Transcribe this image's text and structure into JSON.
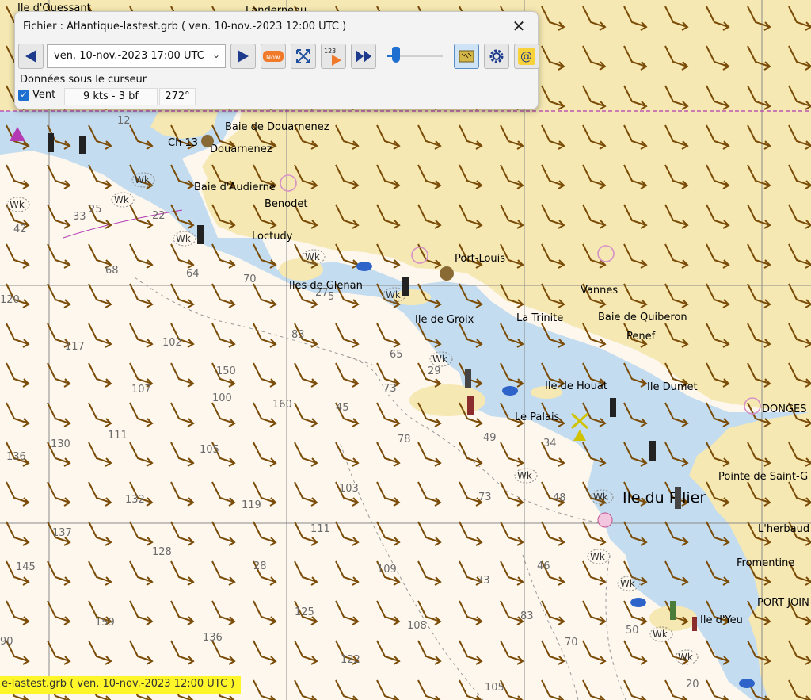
{
  "panel": {
    "title": "Fichier : Atlantique-lastest.grb ( ven. 10-nov.-2023 12:00  UTC )",
    "date_select": "ven. 10-nov.-2023 17:00  UTC",
    "now_label": "Now",
    "step_label": "123",
    "slider_fraction": 0.18,
    "cursor_header": "Données sous le curseur",
    "vent_label": "Vent",
    "vent_checked": true,
    "wind_speed": "9 kts -  3 bf",
    "wind_dir": "272°"
  },
  "status": {
    "text": "e-lastest.grb ( ven. 10-nov.-2023 12:00  UTC )"
  },
  "map": {
    "places": [
      {
        "id": "ouessant",
        "text": "Ile d'Ouessant"
      },
      {
        "id": "landerneau",
        "text": "Landerneau"
      },
      {
        "id": "baie-douarnenez",
        "text": "Baie de Douarnenez"
      },
      {
        "id": "ch13",
        "text": "Ch 13"
      },
      {
        "id": "douarnenez",
        "text": "Douarnenez"
      },
      {
        "id": "baie-audierne",
        "text": "Baie d'Audierne"
      },
      {
        "id": "benodet",
        "text": "Benodet"
      },
      {
        "id": "loctudy",
        "text": "Loctudy"
      },
      {
        "id": "glenan",
        "text": "Iles de Glenan"
      },
      {
        "id": "port-louis",
        "text": "Port-Louis"
      },
      {
        "id": "vannes",
        "text": "Vannes"
      },
      {
        "id": "ile-groix",
        "text": "Ile de Groix"
      },
      {
        "id": "la-trinite",
        "text": "La Trinite"
      },
      {
        "id": "baie-quiberon",
        "text": "Baie de Quiberon"
      },
      {
        "id": "penef",
        "text": "Penef"
      },
      {
        "id": "ile-houat",
        "text": "Ile de Houat"
      },
      {
        "id": "ile-dumet",
        "text": "Ile Dumet"
      },
      {
        "id": "le-palais",
        "text": "Le Palais"
      },
      {
        "id": "donges",
        "text": "DONGES"
      },
      {
        "id": "pointe-st-g",
        "text": "Pointe de Saint-G"
      },
      {
        "id": "lherbaud",
        "text": "L'herbaud"
      },
      {
        "id": "fromentine",
        "text": "Fromentine"
      },
      {
        "id": "port-join",
        "text": "PORT JOIN"
      },
      {
        "id": "ile-yeu",
        "text": "Ile d'Yeu"
      }
    ],
    "ile_du_pilier": "Ile du Pilier",
    "depths": [
      "12",
      "33",
      "25",
      "22",
      "42",
      "68",
      "70",
      "64",
      "27",
      "5",
      "120",
      "117",
      "102",
      "83",
      "65",
      "150",
      "107",
      "100",
      "160",
      "45",
      "73",
      "29",
      "111",
      "130",
      "105",
      "78",
      "49",
      "34",
      "136",
      "132",
      "119",
      "103",
      "73",
      "48",
      "137",
      "111",
      "145",
      "128",
      "28",
      "109",
      "46",
      "159",
      "125",
      "73",
      "83",
      "108",
      "136",
      "70",
      "50",
      "90",
      "122",
      "105",
      "20"
    ],
    "wk_label": "Wk"
  },
  "colors": {
    "land": "#f5e8b2",
    "sea_shallow": "#c4dcef",
    "sea_deep": "#fdf7ee",
    "arrow": "#7a4c08",
    "status_bg": "#fff62a"
  }
}
